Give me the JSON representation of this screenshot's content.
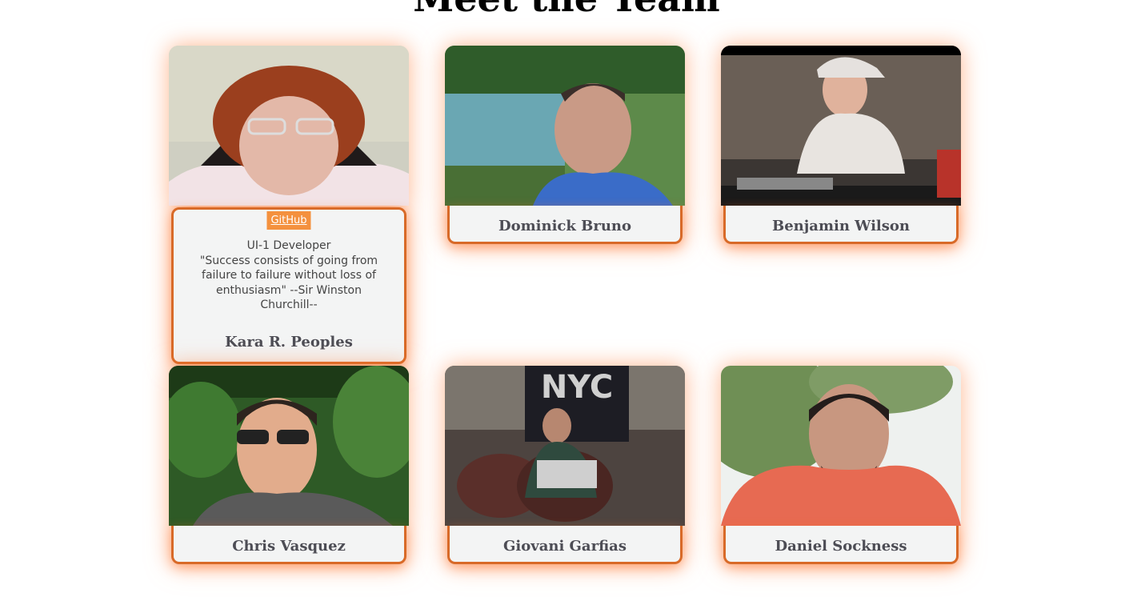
{
  "page": {
    "title": "Meet the Team"
  },
  "team": [
    {
      "name": "Kara R. Peoples",
      "link": "GitHub",
      "role": "UI-1 Developer",
      "quote": "\"Success consists of going from failure to failure without loss of enthusiasm\" --Sir Winston Churchill--"
    },
    {
      "name": "Dominick Bruno"
    },
    {
      "name": "Benjamin Wilson"
    },
    {
      "name": "Chris Vasquez"
    },
    {
      "name": "Giovani Garfias"
    },
    {
      "name": "Daniel Sockness"
    }
  ],
  "colors": {
    "accent": "#d86a28",
    "glow": "#ff7a32",
    "card_bg": "#f3f4f4",
    "link_bg": "#f4913e"
  }
}
